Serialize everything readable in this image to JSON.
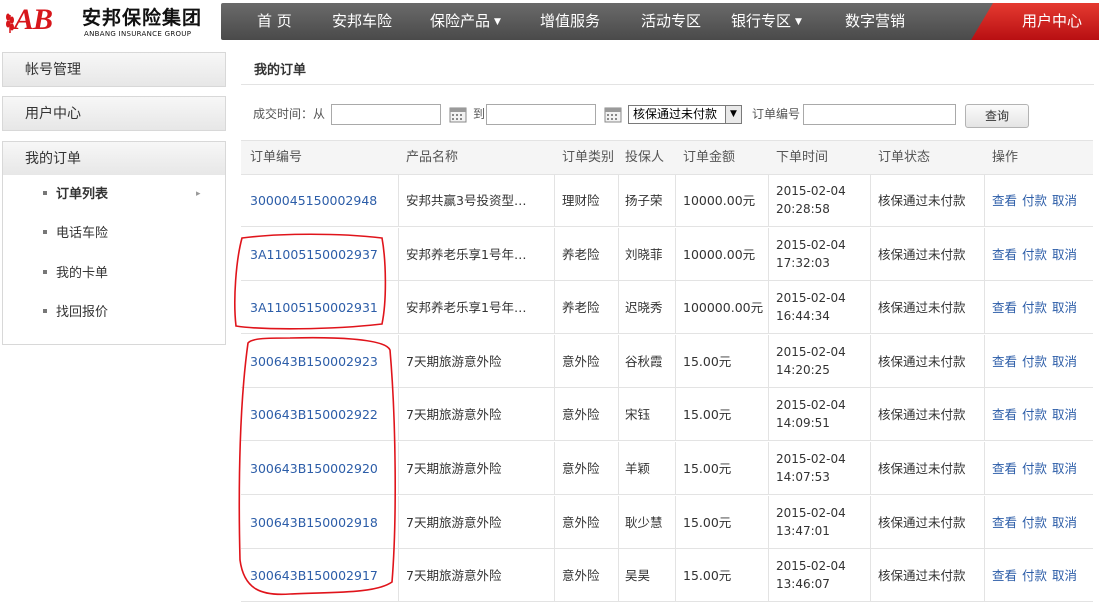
{
  "logo": {
    "mark": "AB",
    "name_cn": "安邦保险集团",
    "name_en": "ANBANG INSURANCE GROUP"
  },
  "nav": {
    "items": [
      {
        "label": "首 页"
      },
      {
        "label": "安邦车险"
      },
      {
        "label": "保险产品",
        "dropdown": true
      },
      {
        "label": "增值服务"
      },
      {
        "label": "活动专区"
      },
      {
        "label": "银行专区",
        "dropdown": true
      },
      {
        "label": "数字营销"
      }
    ],
    "user_center": "用户中心"
  },
  "sidebar": {
    "sections": [
      {
        "label": "帐号管理"
      },
      {
        "label": "用户中心"
      },
      {
        "label": "我的订单"
      }
    ],
    "sub_items": [
      {
        "label": "订单列表",
        "active": true
      },
      {
        "label": "电话车险"
      },
      {
        "label": "我的卡单"
      },
      {
        "label": "找回报价"
      }
    ]
  },
  "main": {
    "title": "我的订单",
    "filter": {
      "time_label": "成交时间：从",
      "to_label": "到",
      "from_value": "",
      "to_value": "",
      "status_selected": "核保通过未付款",
      "order_no_label": "订单编号",
      "order_no_value": "",
      "query_button": "查询"
    }
  },
  "table": {
    "headers": [
      "订单编号",
      "产品名称",
      "订单类别",
      "投保人",
      "订单金额",
      "下单时间",
      "订单状态",
      "操作"
    ],
    "rows": [
      {
        "order_no": "3000045150002948",
        "product": "安邦共赢3号投资型…",
        "category": "理财险",
        "holder": "扬子荣",
        "amount": "10000.00元",
        "date": "2015-02-04",
        "time": "20:28:58",
        "status": "核保通过未付款"
      },
      {
        "order_no": "3A11005150002937",
        "product": "安邦养老乐享1号年…",
        "category": "养老险",
        "holder": "刘晓菲",
        "amount": "10000.00元",
        "date": "2015-02-04",
        "time": "17:32:03",
        "status": "核保通过未付款"
      },
      {
        "order_no": "3A11005150002931",
        "product": "安邦养老乐享1号年…",
        "category": "养老险",
        "holder": "迟晓秀",
        "amount": "100000.00元",
        "date": "2015-02-04",
        "time": "16:44:34",
        "status": "核保通过未付款"
      },
      {
        "order_no": "300643B150002923",
        "product": "7天期旅游意外险",
        "category": "意外险",
        "holder": "谷秋霞",
        "amount": "15.00元",
        "date": "2015-02-04",
        "time": "14:20:25",
        "status": "核保通过未付款"
      },
      {
        "order_no": "300643B150002922",
        "product": "7天期旅游意外险",
        "category": "意外险",
        "holder": "宋钰",
        "amount": "15.00元",
        "date": "2015-02-04",
        "time": "14:09:51",
        "status": "核保通过未付款"
      },
      {
        "order_no": "300643B150002920",
        "product": "7天期旅游意外险",
        "category": "意外险",
        "holder": "羊颖",
        "amount": "15.00元",
        "date": "2015-02-04",
        "time": "14:07:53",
        "status": "核保通过未付款"
      },
      {
        "order_no": "300643B150002918",
        "product": "7天期旅游意外险",
        "category": "意外险",
        "holder": "耿少慧",
        "amount": "15.00元",
        "date": "2015-02-04",
        "time": "13:47:01",
        "status": "核保通过未付款"
      },
      {
        "order_no": "300643B150002917",
        "product": "7天期旅游意外险",
        "category": "意外险",
        "holder": "吴昊",
        "amount": "15.00元",
        "date": "2015-02-04",
        "time": "13:46:07",
        "status": "核保通过未付款"
      }
    ],
    "actions": [
      "查看",
      "付款",
      "取消"
    ]
  },
  "colors": {
    "brand_red": "#d7161b",
    "nav_bg": "#555555",
    "link": "#2c5da8",
    "annotation": "#e0141b"
  }
}
